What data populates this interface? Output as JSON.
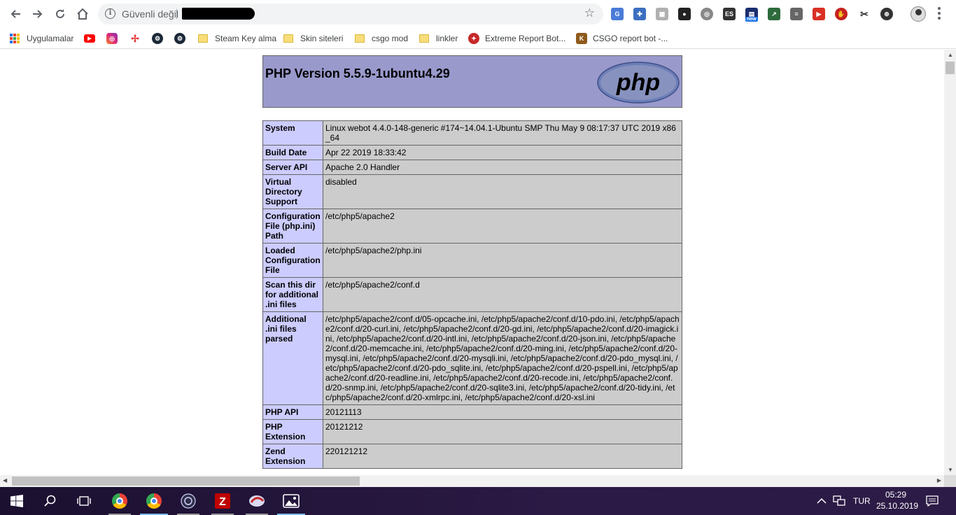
{
  "browser": {
    "security_label": "Güvenli değil",
    "url_redacted": true,
    "bookmarks": [
      {
        "label": "Uygulamalar",
        "icon": "apps-icon"
      },
      {
        "label": "",
        "icon": "youtube-icon"
      },
      {
        "label": "",
        "icon": "instagram-icon"
      },
      {
        "label": "",
        "icon": "pinwheel-icon"
      },
      {
        "label": "",
        "icon": "steam-icon"
      },
      {
        "label": "",
        "icon": "steam-icon"
      },
      {
        "label": "Steam Key alma",
        "icon": "folder-icon"
      },
      {
        "label": "Skin siteleri",
        "icon": "folder-icon"
      },
      {
        "label": "csgo mod",
        "icon": "folder-icon"
      },
      {
        "label": "linkler",
        "icon": "folder-icon"
      },
      {
        "label": "Extreme Report Bot...",
        "icon": "extreme-report-icon"
      },
      {
        "label": "CSGO report bot -...",
        "icon": "csgo-report-icon"
      }
    ],
    "extension_badges": {
      "es": "ES",
      "new": "new"
    }
  },
  "php": {
    "title": "PHP Version 5.5.9-1ubuntu4.29",
    "logo_text": "php",
    "rows": [
      {
        "key": "System",
        "value": "Linux webot 4.4.0-148-generic #174~14.04.1-Ubuntu SMP Thu May 9 08:17:37 UTC 2019 x86_64"
      },
      {
        "key": "Build Date",
        "value": "Apr 22 2019 18:33:42"
      },
      {
        "key": "Server API",
        "value": "Apache 2.0 Handler"
      },
      {
        "key": "Virtual Directory Support",
        "value": "disabled"
      },
      {
        "key": "Configuration File (php.ini) Path",
        "value": "/etc/php5/apache2"
      },
      {
        "key": "Loaded Configuration File",
        "value": "/etc/php5/apache2/php.ini"
      },
      {
        "key": "Scan this dir for additional .ini files",
        "value": "/etc/php5/apache2/conf.d"
      },
      {
        "key": "Additional .ini files parsed",
        "value": "/etc/php5/apache2/conf.d/05-opcache.ini, /etc/php5/apache2/conf.d/10-pdo.ini, /etc/php5/apache2/conf.d/20-curl.ini, /etc/php5/apache2/conf.d/20-gd.ini, /etc/php5/apache2/conf.d/20-imagick.ini, /etc/php5/apache2/conf.d/20-intl.ini, /etc/php5/apache2/conf.d/20-json.ini, /etc/php5/apache2/conf.d/20-memcache.ini, /etc/php5/apache2/conf.d/20-ming.ini, /etc/php5/apache2/conf.d/20-mysql.ini, /etc/php5/apache2/conf.d/20-mysqli.ini, /etc/php5/apache2/conf.d/20-pdo_mysql.ini, /etc/php5/apache2/conf.d/20-pdo_sqlite.ini, /etc/php5/apache2/conf.d/20-pspell.ini, /etc/php5/apache2/conf.d/20-readline.ini, /etc/php5/apache2/conf.d/20-recode.ini, /etc/php5/apache2/conf.d/20-snmp.ini, /etc/php5/apache2/conf.d/20-sqlite3.ini, /etc/php5/apache2/conf.d/20-tidy.ini, /etc/php5/apache2/conf.d/20-xmlrpc.ini, /etc/php5/apache2/conf.d/20-xsl.ini"
      },
      {
        "key": "PHP API",
        "value": "20121113"
      },
      {
        "key": "PHP Extension",
        "value": "20121212"
      },
      {
        "key": "Zend Extension",
        "value": "220121212"
      }
    ]
  },
  "taskbar": {
    "language": "TUR",
    "time": "05:29",
    "date": "25.10.2019"
  },
  "colors": {
    "php_header_bg": "#9999cc",
    "php_key_bg": "#ccccff",
    "php_value_bg": "#cccccc",
    "taskbar_bg": "#24163a"
  }
}
